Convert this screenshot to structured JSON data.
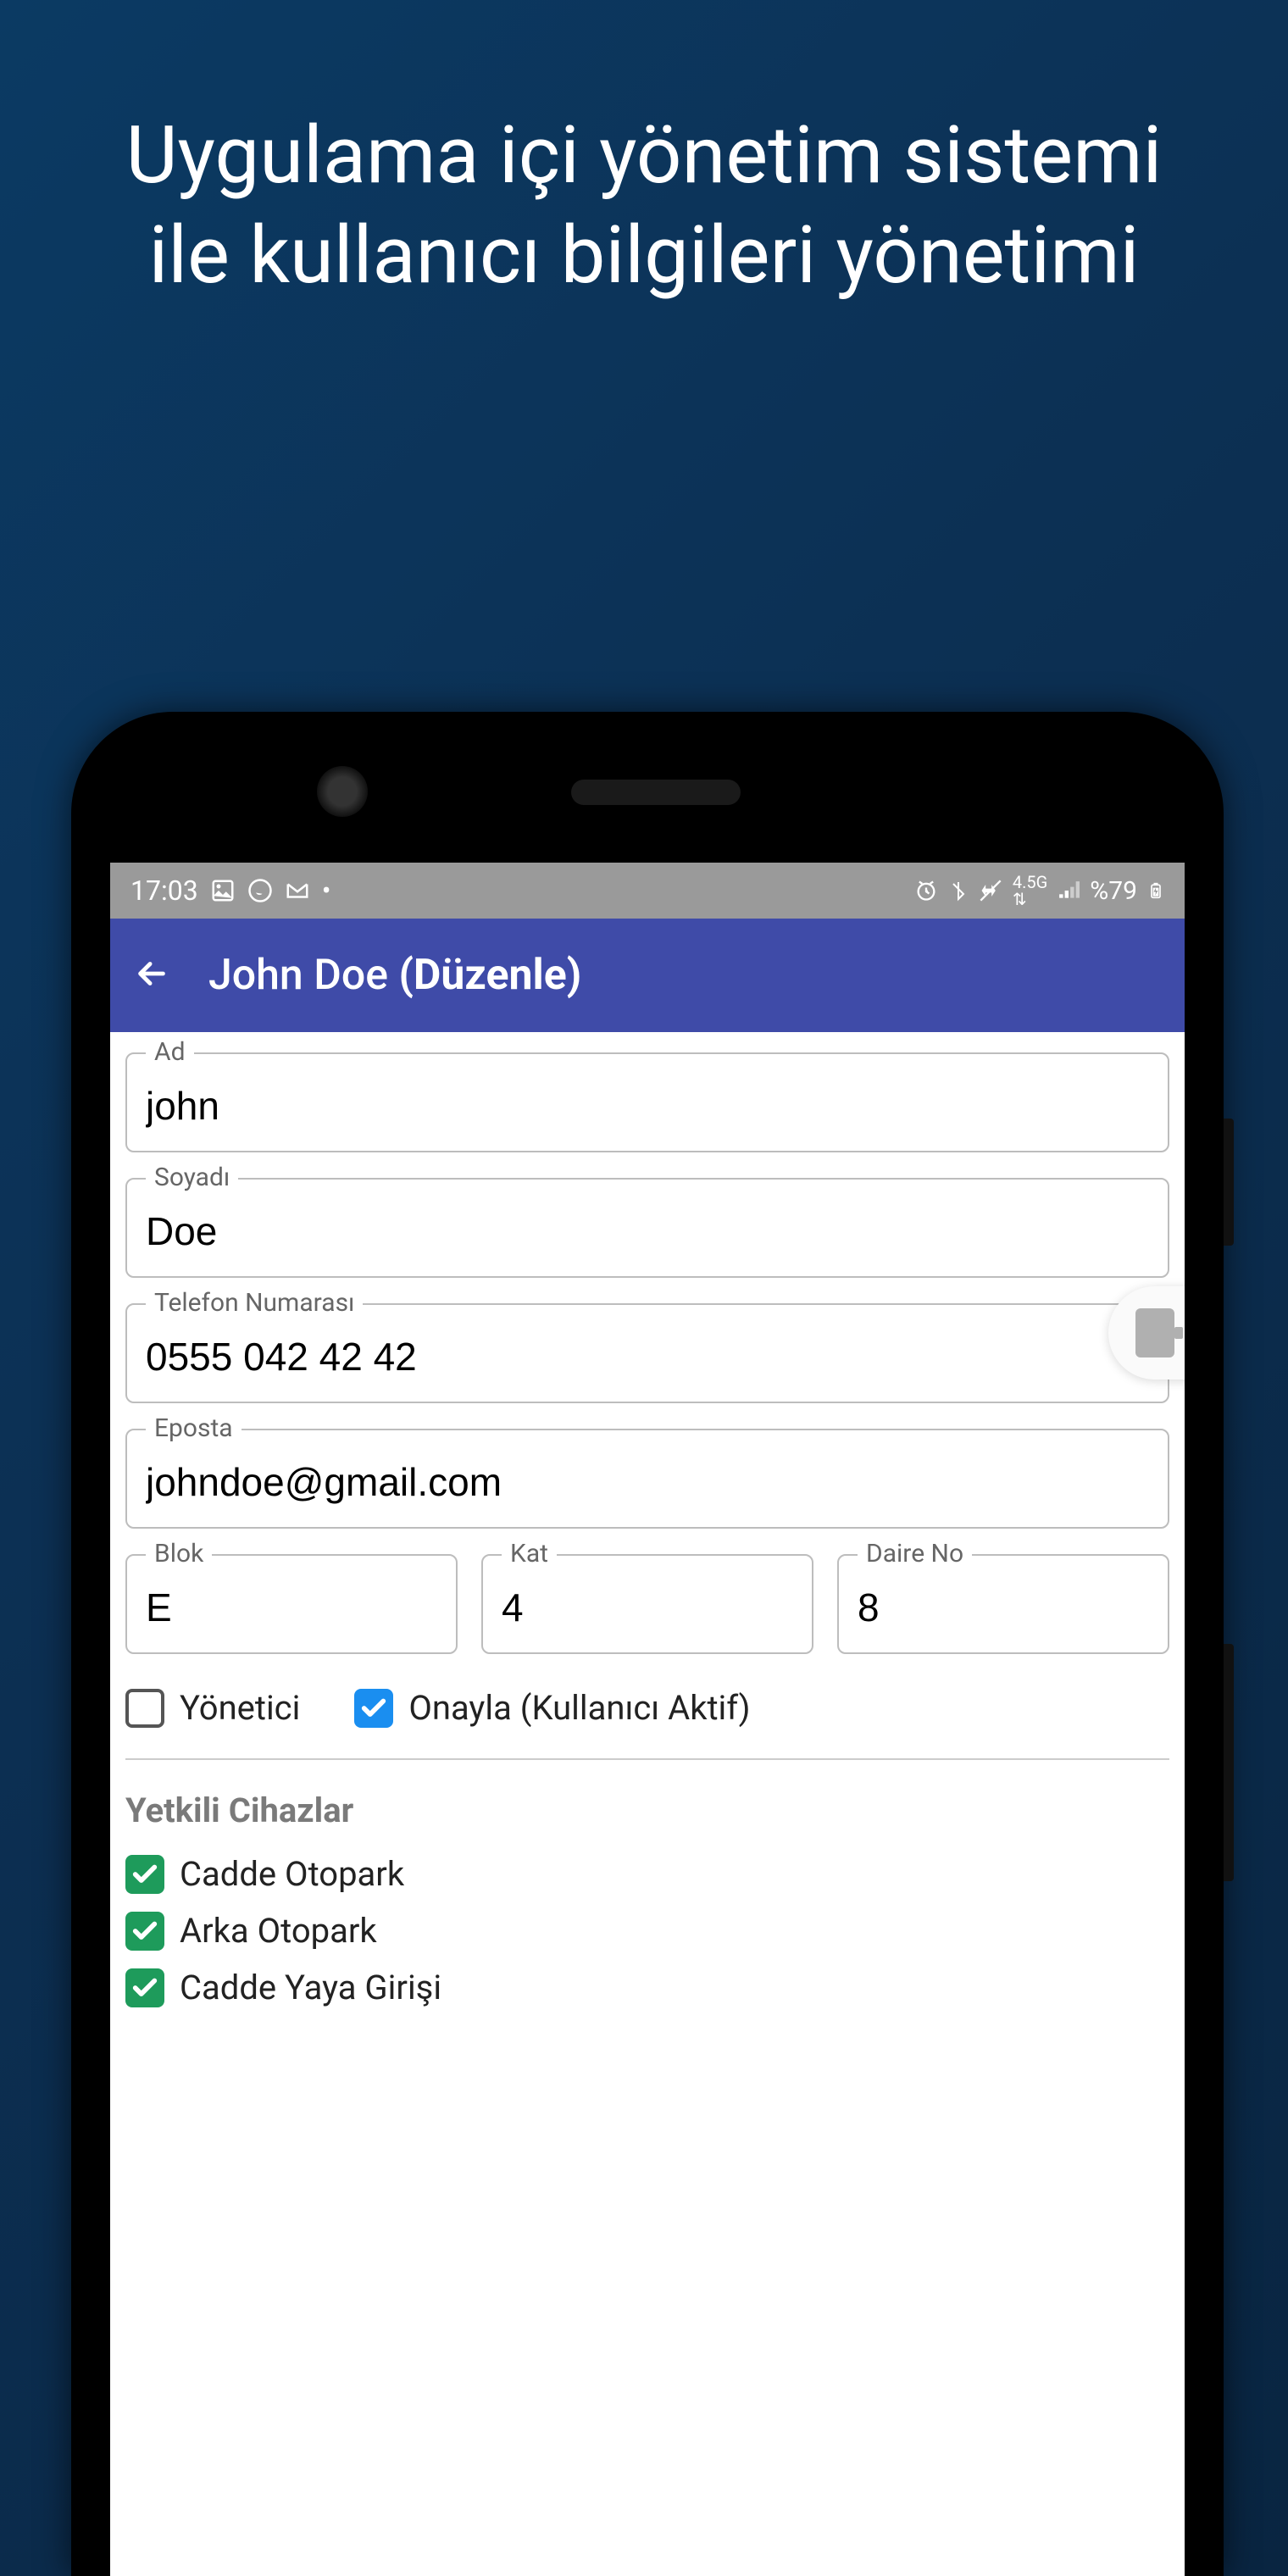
{
  "promo": {
    "text": "Uygulama içi yönetim sistemi ile kullanıcı bilgileri yönetimi"
  },
  "status_bar": {
    "time": "17:03",
    "battery_text": "%79"
  },
  "app_bar": {
    "title_name": "John Doe",
    "title_action": "(Düzenle)"
  },
  "fields": {
    "ad": {
      "label": "Ad",
      "value": "john"
    },
    "soyadi": {
      "label": "Soyadı",
      "value": "Doe"
    },
    "telefon": {
      "label": "Telefon Numarası",
      "value": "0555 042 42 42"
    },
    "eposta": {
      "label": "Eposta",
      "value": "johndoe@gmail.com"
    },
    "blok": {
      "label": "Blok",
      "value": "E"
    },
    "kat": {
      "label": "Kat",
      "value": "4"
    },
    "daire": {
      "label": "Daire No",
      "value": "8"
    }
  },
  "checkboxes": {
    "yonetici": {
      "label": "Yönetici",
      "checked": false
    },
    "onayla": {
      "label": "Onayla (Kullanıcı Aktif)",
      "checked": true
    }
  },
  "devices": {
    "heading": "Yetkili Cihazlar",
    "items": [
      {
        "label": "Cadde Otopark",
        "checked": true
      },
      {
        "label": "Arka Otopark",
        "checked": true
      },
      {
        "label": "Cadde Yaya Girişi",
        "checked": true
      }
    ]
  }
}
